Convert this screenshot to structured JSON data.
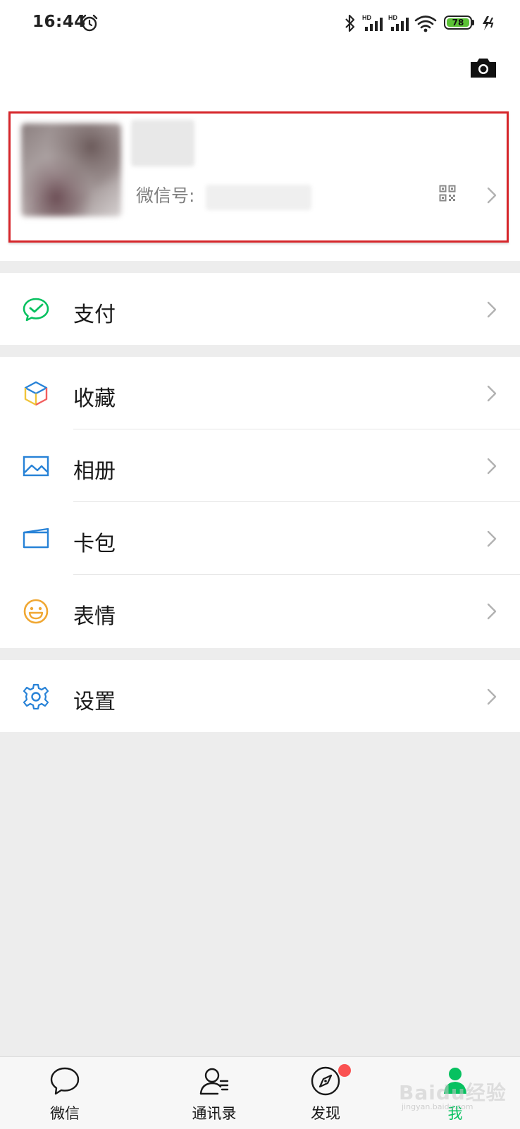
{
  "status_bar": {
    "time": "16:44",
    "network_label_1": "HD",
    "network_label_2": "HD",
    "battery_level": "78"
  },
  "header": {
    "camera_icon": "camera-icon"
  },
  "profile": {
    "nickname": "",
    "wechat_id_label": "微信号:",
    "wechat_id_value": "",
    "qr_icon": "qr-code-icon",
    "highlight_color": "#d6252a"
  },
  "menu": {
    "pay": {
      "label": "支付",
      "icon": "wechat-pay-icon",
      "color": "#07c160"
    },
    "favorites": {
      "label": "收藏",
      "icon": "favorites-cube-icon"
    },
    "album": {
      "label": "相册",
      "icon": "photo-album-icon",
      "color": "#2782d7"
    },
    "card_wallet": {
      "label": "卡包",
      "icon": "card-wallet-icon",
      "color": "#2782d7"
    },
    "stickers": {
      "label": "表情",
      "icon": "sticker-smile-icon",
      "color": "#f0a732"
    },
    "settings": {
      "label": "设置",
      "icon": "settings-gear-icon",
      "color": "#2782d7"
    }
  },
  "tabbar": {
    "tabs": [
      {
        "label": "微信",
        "icon": "chat-bubble-icon",
        "active": false
      },
      {
        "label": "通讯录",
        "icon": "contacts-icon",
        "active": false
      },
      {
        "label": "发现",
        "icon": "compass-icon",
        "active": false,
        "badge": true
      },
      {
        "label": "我",
        "icon": "me-person-icon",
        "active": true
      }
    ],
    "active_color": "#07c160",
    "badge_color": "#fa5151"
  },
  "watermark": {
    "text": "Baidu经验",
    "sub": "jingyan.baidu.com"
  }
}
